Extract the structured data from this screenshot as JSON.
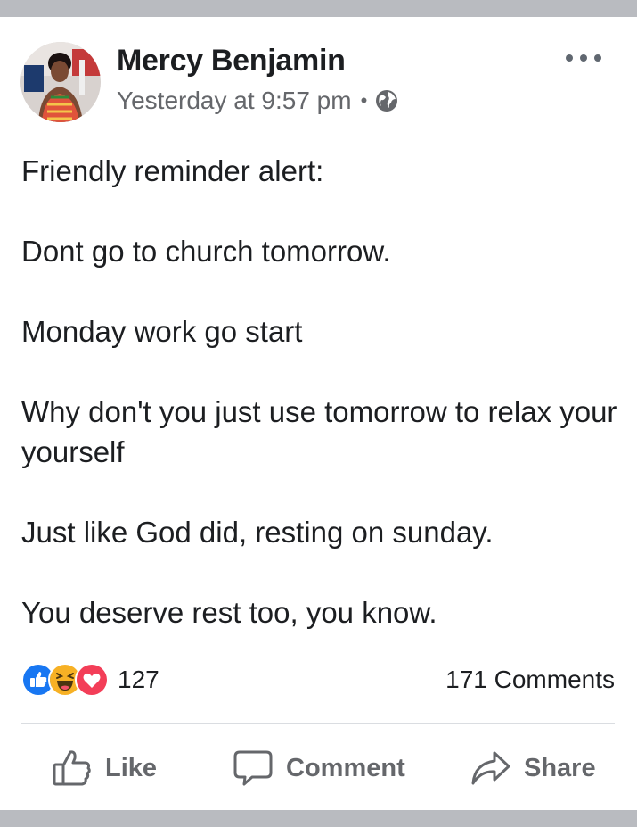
{
  "post": {
    "author": "Mercy Benjamin",
    "timestamp": "Yesterday at 9:57 pm",
    "separator": "•",
    "privacy_icon": "globe-icon",
    "more_icon": "more-options-icon",
    "body": [
      "Friendly reminder alert:",
      "Dont go to church tomorrow.",
      "Monday work go start",
      "Why don't you just use tomorrow to relax your yourself",
      "Just like God did, resting on sunday.",
      "You deserve rest too, you know."
    ]
  },
  "stats": {
    "reaction_icons": [
      "like-reaction-icon",
      "haha-reaction-icon",
      "love-reaction-icon"
    ],
    "reaction_count": "127",
    "comments": "171 Comments"
  },
  "actions": {
    "like": "Like",
    "comment": "Comment",
    "share": "Share"
  },
  "colors": {
    "text": "#1c1e21",
    "secondary": "#65676b",
    "like_blue": "#1877f2",
    "love_red": "#f33e58",
    "haha_yellow": "#f7b125",
    "frame_gray": "#b9bbc0"
  }
}
